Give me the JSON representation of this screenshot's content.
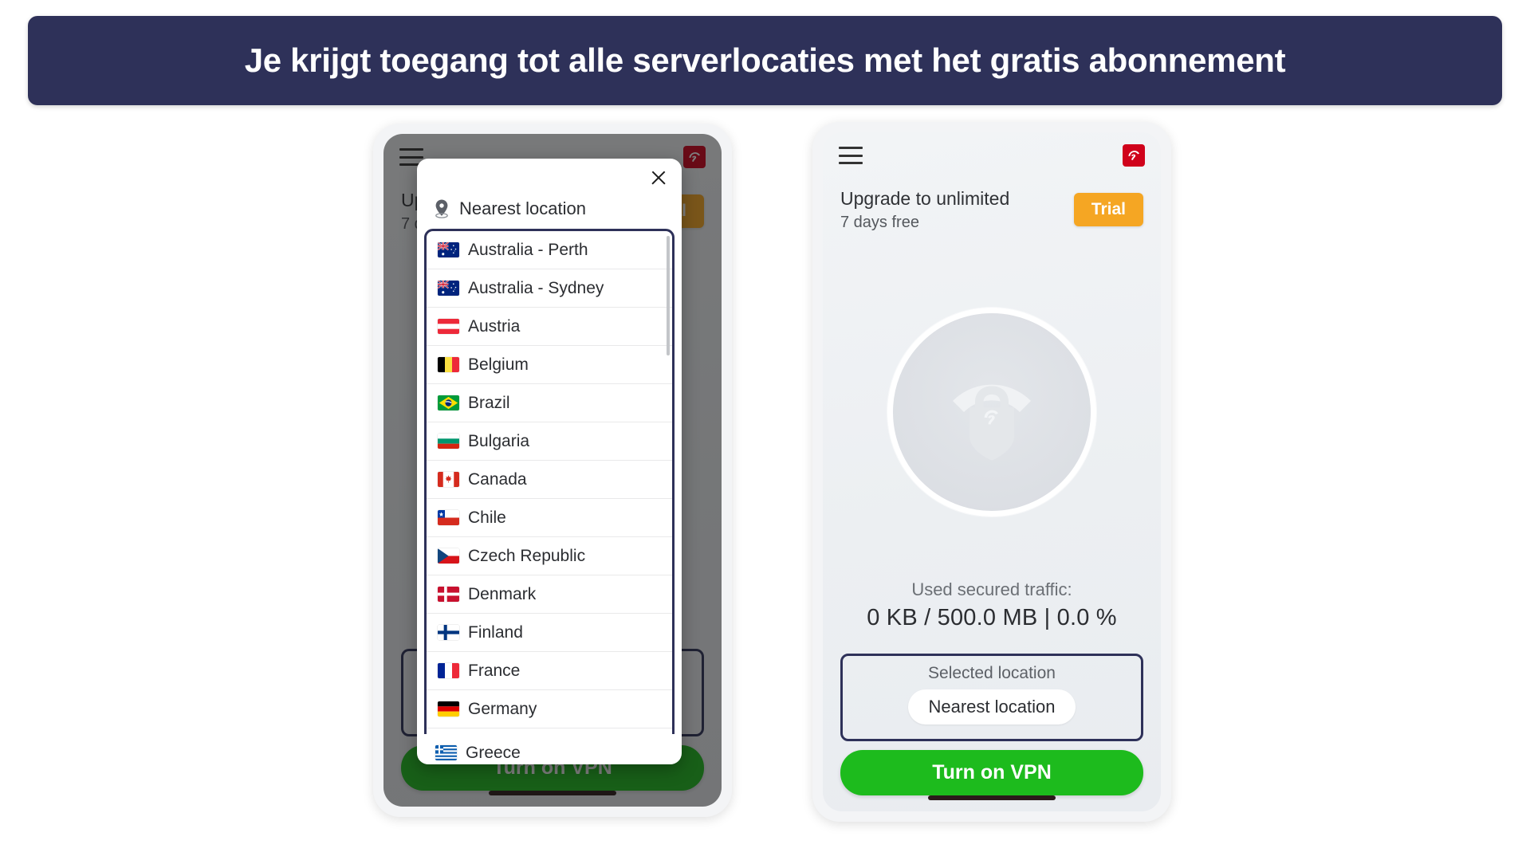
{
  "banner": {
    "text": "Je krijgt toegang tot alle serverlocaties met het gratis abonnement",
    "bg_color": "#2e3159",
    "text_color": "#ffffff"
  },
  "colors": {
    "accent_navy": "#2e3159",
    "brand_red": "#d0021b",
    "trial_orange": "#f5a623",
    "vpn_green": "#1dbb1d"
  },
  "app": {
    "topbar": {
      "menu_icon": "hamburger-icon",
      "logo_icon": "avira-logo-icon"
    },
    "upgrade": {
      "title": "Upgrade to unlimited",
      "subtitle": "7 days free",
      "badge": "Trial"
    },
    "vpn_status_icon": "vpn-shield-wifi-lock-icon",
    "traffic": {
      "label": "Used secured traffic:",
      "value": "0 KB / 500.0 MB  |  0.0 %"
    },
    "selected_location": {
      "label": "Selected location",
      "value": "Nearest location"
    },
    "vpn_button": "Turn on VPN"
  },
  "dialog": {
    "close_icon": "close-icon",
    "nearest": {
      "icon": "map-pin-icon",
      "label": "Nearest location"
    },
    "locations": [
      {
        "name": "Australia - Perth",
        "flag": "au"
      },
      {
        "name": "Australia - Sydney",
        "flag": "au"
      },
      {
        "name": "Austria",
        "flag": "at"
      },
      {
        "name": "Belgium",
        "flag": "be"
      },
      {
        "name": "Brazil",
        "flag": "br"
      },
      {
        "name": "Bulgaria",
        "flag": "bg"
      },
      {
        "name": "Canada",
        "flag": "ca"
      },
      {
        "name": "Chile",
        "flag": "cl"
      },
      {
        "name": "Czech Republic",
        "flag": "cz"
      },
      {
        "name": "Denmark",
        "flag": "dk"
      },
      {
        "name": "Finland",
        "flag": "fi"
      },
      {
        "name": "France",
        "flag": "fr"
      },
      {
        "name": "Germany",
        "flag": "de"
      }
    ],
    "partial_next": {
      "name": "Greece",
      "flag": "gr"
    }
  }
}
